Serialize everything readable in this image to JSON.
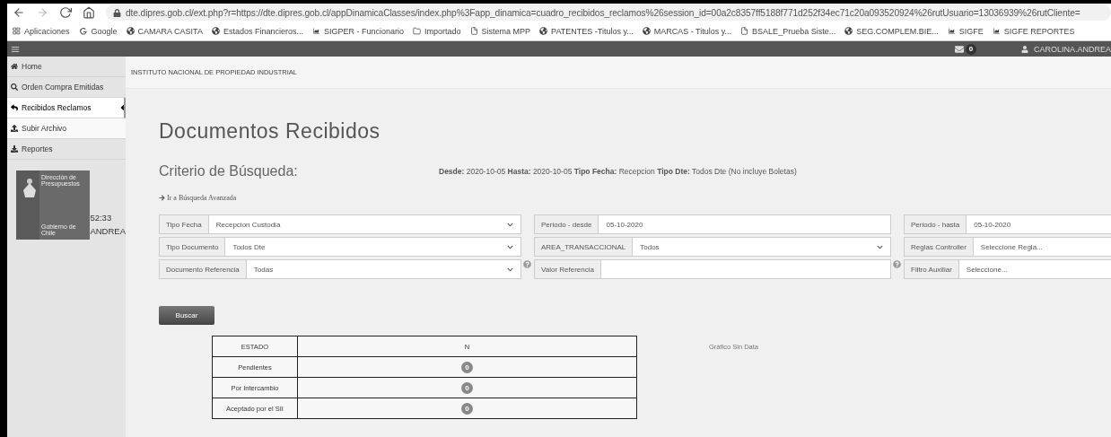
{
  "browser": {
    "url": "dte.dipres.gob.cl/ext.php?r=https://dte.dipres.gob.cl/appDinamicaClasses/index.php%3Fapp_dinamica=cuadro_recibidos_reclamos%26session_id=00a2c8357ff5188f771d252f34ec71c20a093520924%26rutUsuario=13036939%26rutCliente=",
    "bookmarks": [
      {
        "kind": "apps",
        "label": "Aplicaciones"
      },
      {
        "kind": "google",
        "label": "Google"
      },
      {
        "kind": "globe",
        "label": "CAMARA CASITA"
      },
      {
        "kind": "globe",
        "label": "Estados Financieros..."
      },
      {
        "kind": "chart",
        "label": "SIGPER - Funcionario"
      },
      {
        "kind": "folder",
        "label": "Importado"
      },
      {
        "kind": "doc",
        "label": "Sistema MPP"
      },
      {
        "kind": "globe",
        "label": "PATENTES -Titulos y..."
      },
      {
        "kind": "globe",
        "label": "MARCAS - Titulos y..."
      },
      {
        "kind": "bsale",
        "label": "BSALE_Prueba Siste..."
      },
      {
        "kind": "globe",
        "label": "SEG.COMPLEM.BIE..."
      },
      {
        "kind": "chart",
        "label": "SIGFE"
      },
      {
        "kind": "chart",
        "label": "SIGFE REPORTES"
      }
    ]
  },
  "header": {
    "messages": "0",
    "user": "CAROLINA.ANDREA"
  },
  "sidebar": {
    "items": [
      {
        "label": "Home",
        "selected": false,
        "highlighted": false
      },
      {
        "label": "Orden Compra Emitidas",
        "selected": false,
        "highlighted": false
      },
      {
        "label": "Recibidos Reclamos",
        "selected": true,
        "highlighted": true
      },
      {
        "label": "Subir Archivo",
        "selected": false,
        "highlighted": true
      },
      {
        "label": "Reportes",
        "selected": false,
        "highlighted": false
      }
    ],
    "logo": {
      "line_1": "Dirección de Presupuestos",
      "line_2": "Gobierno de Chile"
    },
    "time": "52:33",
    "user": "ANDREA"
  },
  "breadcrumb": "INSTITUTO NACIONAL DE PROPIEDAD INDUSTRIAL",
  "title": "Documentos Recibidos",
  "criteria": {
    "heading": "Criterio de Búsqueda:",
    "summary": "**Desde:** 2020-10-05 **Hasta:** 2020-10-05 **Tipo Fecha:** Recepcion **Tipo Dte:** Todos Dte (No incluye Boletas)",
    "advanced_link": "Ir a Búsqueda Avanzada"
  },
  "filters": [
    {
      "kind": "select",
      "label": "Tipo Fecha",
      "value": "Recepcion Custodia",
      "help": false
    },
    {
      "kind": "input",
      "label": "Periodo - desde",
      "value": "05-10-2020",
      "help": false
    },
    {
      "kind": "input",
      "label": "Periodo - hasta",
      "value": "05-10-2020",
      "help": false
    },
    {
      "kind": "select",
      "label": "Tipo Documento",
      "value": "Todos Dte",
      "help": false
    },
    {
      "kind": "select",
      "label": "AREA_TRANSACCIONAL",
      "value": "Todos",
      "help": false
    },
    {
      "kind": "input",
      "label": "Reglas Controller",
      "value": "Seleccione Regla...",
      "help": false
    },
    {
      "kind": "select",
      "label": "Documento Referencia",
      "value": "Todas",
      "help": true
    },
    {
      "kind": "input",
      "label": "Valor Referencia",
      "help": true
    },
    {
      "kind": "input",
      "label": "Filtro Auxiliar",
      "value": "Seleccione...",
      "help": false
    }
  ],
  "search_button": "Buscar",
  "table": {
    "columns": [
      "ESTADO",
      "N"
    ],
    "rows": [
      {
        "estado": "Pendientes",
        "n": "0"
      },
      {
        "estado": "Por Intercambio",
        "n": "0"
      },
      {
        "estado": "Aceptado por el SII",
        "n": "0"
      }
    ]
  },
  "chart_note": "Gráfico Sin Data"
}
